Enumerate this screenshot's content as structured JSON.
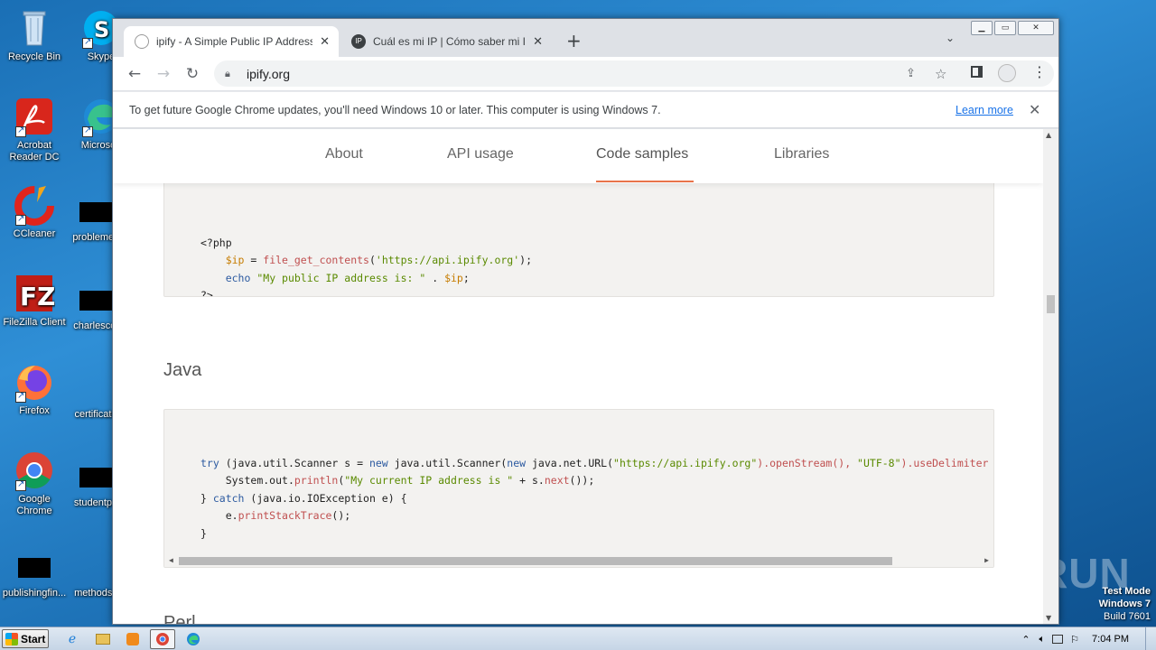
{
  "desktop": {
    "icons": [
      {
        "label": "Recycle Bin",
        "icon": "recycle-bin-icon"
      },
      {
        "label": "Skype",
        "icon": "skype-icon"
      },
      {
        "label": "Acrobat Reader DC",
        "icon": "acrobat-icon"
      },
      {
        "label": "Microsoft",
        "icon": "edge-icon"
      },
      {
        "label": "CCleaner",
        "icon": "ccleaner-icon"
      },
      {
        "label": "problemev",
        "icon": "file-thumbnail-icon"
      },
      {
        "label": "FileZilla Client",
        "icon": "filezilla-icon"
      },
      {
        "label": "charlescol",
        "icon": "file-thumbnail-icon"
      },
      {
        "label": "Firefox",
        "icon": "firefox-icon"
      },
      {
        "label": "certificate",
        "icon": "file-thumbnail-icon"
      },
      {
        "label": "Google Chrome",
        "icon": "chrome-icon"
      },
      {
        "label": "studentpa",
        "icon": "file-thumbnail-icon"
      },
      {
        "label": "publishingfin...",
        "icon": "file-thumbnail-icon"
      },
      {
        "label": "methodsc",
        "icon": "file-thumbnail-icon"
      }
    ]
  },
  "browser": {
    "tabs": [
      {
        "title": "ipify - A Simple Public IP Address API",
        "active": true
      },
      {
        "title": "Cuál es mi IP | Cómo saber mi IP públ",
        "active": false
      }
    ],
    "new_tab": "+",
    "url": "ipify.org",
    "infobar": {
      "message": "To get future Google Chrome updates, you'll need Windows 10 or later. This computer is using Windows 7.",
      "link": "Learn more"
    }
  },
  "site": {
    "nav": [
      "About",
      "API usage",
      "Code samples",
      "Libraries"
    ],
    "active_nav": "Code samples",
    "sections": {
      "java_heading": "Java",
      "perl_heading": "Perl"
    },
    "php_code": {
      "l1": "<?php",
      "l2_var": "$ip",
      "l2_eq": " = ",
      "l2_fn": "file_get_contents",
      "l2_str": "'https://api.ipify.org'",
      "l3_kw": "echo",
      "l3_str": "\"My public IP address is: \"",
      "l3_dot": " . ",
      "l3_var": "$ip",
      "l4": "?>"
    },
    "java_code": {
      "try": "try",
      "l1_rest_a": " (java.util.Scanner s = ",
      "new1": "new",
      "l1_rest_b": " java.util.Scanner(",
      "new2": "new",
      "l1_rest_c": " java.net.URL(",
      "url_str": "\"https://api.ipify.org\"",
      "open_stream": ").openStream(), ",
      "utf": "\"UTF-8\"",
      "use_delim": ").useDelimiter",
      "l2_a": "System.out.",
      "l2_fn": "println",
      "l2_str": "\"My current IP address is \"",
      "l2_b": " + s.",
      "l2_next": "next",
      "l2_c": "());",
      "catch_a": "} ",
      "catch": "catch",
      "catch_b": " (java.io.IOException e) {",
      "l4_a": "e.",
      "l4_fn": "printStackTrace",
      "l4_b": "();",
      "l5": "}"
    }
  },
  "overlay": {
    "watermark": "ANY RUN",
    "testmode": [
      "Test Mode",
      "Windows 7",
      "Build 7601"
    ]
  },
  "taskbar": {
    "start": "Start",
    "clock": "7:04 PM"
  }
}
